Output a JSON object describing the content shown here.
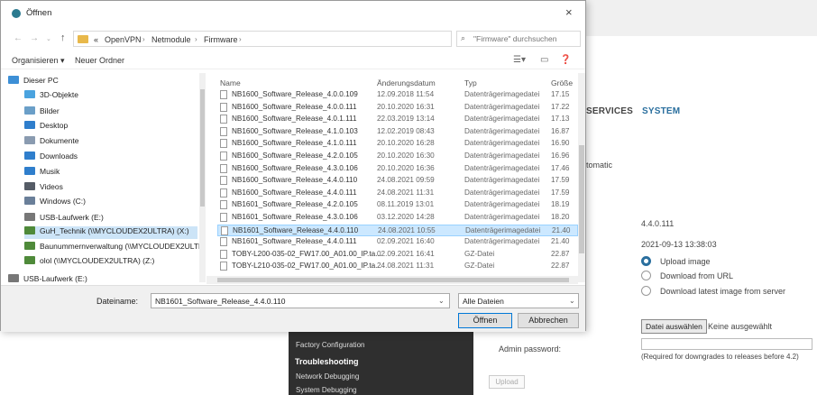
{
  "dialog": {
    "title": "Öffnen",
    "close": "×",
    "breadcrumb": [
      "«",
      "OpenVPN",
      "Netmodule",
      "Firmware"
    ],
    "search_placeholder": "\"Firmware\" durchsuchen",
    "toolbar": {
      "organize": "Organisieren ▾",
      "new_folder": "Neuer Ordner"
    },
    "nav_items": [
      {
        "label": "Dieser PC",
        "icon": "monitor-icon",
        "color": "#3d8fd6"
      },
      {
        "label": "3D-Objekte",
        "icon": "cube-icon",
        "color": "#4aa3df"
      },
      {
        "label": "Bilder",
        "icon": "pictures-icon",
        "color": "#6b9fc8"
      },
      {
        "label": "Desktop",
        "icon": "desktop-icon",
        "color": "#2f7ecc"
      },
      {
        "label": "Dokumente",
        "icon": "document-icon",
        "color": "#8a9bb0"
      },
      {
        "label": "Downloads",
        "icon": "download-icon",
        "color": "#2f7ecc"
      },
      {
        "label": "Musik",
        "icon": "music-icon",
        "color": "#2f7ecc"
      },
      {
        "label": "Videos",
        "icon": "video-icon",
        "color": "#555c66"
      },
      {
        "label": "Windows (C:)",
        "icon": "drive-icon",
        "color": "#6a7f99"
      },
      {
        "label": "USB-Laufwerk (E:)",
        "icon": "usb-drive-icon",
        "color": "#777"
      },
      {
        "label": "GuH_Technik (\\\\MYCLOUDEX2ULTRA) (X:)",
        "icon": "network-drive-icon",
        "color": "#4f8a3a",
        "selected": true
      },
      {
        "label": "Baunummernverwaltung (\\\\MYCLOUDEX2ULTR",
        "icon": "network-drive-icon",
        "color": "#4f8a3a"
      },
      {
        "label": "olol (\\\\MYCLOUDEX2ULTRA) (Z:)",
        "icon": "network-drive-icon",
        "color": "#4f8a3a"
      },
      {
        "label": "USB-Laufwerk (E:)",
        "icon": "usb-drive-icon",
        "color": "#777"
      }
    ],
    "columns": {
      "name": "Name",
      "date": "Änderungsdatum",
      "type": "Typ",
      "size": "Größe"
    },
    "files": [
      {
        "name": "NB1600_Software_Release_4.0.0.109",
        "date": "12.09.2018 11:54",
        "type": "Datenträgerimagedatei",
        "size": "17.15"
      },
      {
        "name": "NB1600_Software_Release_4.0.0.111",
        "date": "20.10.2020 16:31",
        "type": "Datenträgerimagedatei",
        "size": "17.22"
      },
      {
        "name": "NB1600_Software_Release_4.0.1.111",
        "date": "22.03.2019 13:14",
        "type": "Datenträgerimagedatei",
        "size": "17.13"
      },
      {
        "name": "NB1600_Software_Release_4.1.0.103",
        "date": "12.02.2019 08:43",
        "type": "Datenträgerimagedatei",
        "size": "16.87"
      },
      {
        "name": "NB1600_Software_Release_4.1.0.111",
        "date": "20.10.2020 16:28",
        "type": "Datenträgerimagedatei",
        "size": "16.90"
      },
      {
        "name": "NB1600_Software_Release_4.2.0.105",
        "date": "20.10.2020 16:30",
        "type": "Datenträgerimagedatei",
        "size": "16.96"
      },
      {
        "name": "NB1600_Software_Release_4.3.0.106",
        "date": "20.10.2020 16:36",
        "type": "Datenträgerimagedatei",
        "size": "17.46"
      },
      {
        "name": "NB1600_Software_Release_4.4.0.110",
        "date": "24.08.2021 09:59",
        "type": "Datenträgerimagedatei",
        "size": "17.59"
      },
      {
        "name": "NB1600_Software_Release_4.4.0.111",
        "date": "24.08.2021 11:31",
        "type": "Datenträgerimagedatei",
        "size": "17.59"
      },
      {
        "name": "NB1601_Software_Release_4.2.0.105",
        "date": "08.11.2019 13:01",
        "type": "Datenträgerimagedatei",
        "size": "18.19"
      },
      {
        "name": "NB1601_Software_Release_4.3.0.106",
        "date": "03.12.2020 14:28",
        "type": "Datenträgerimagedatei",
        "size": "18.20"
      },
      {
        "name": "NB1601_Software_Release_4.4.0.110",
        "date": "24.08.2021 10:55",
        "type": "Datenträgerimagedatei",
        "size": "21.40",
        "selected": true
      },
      {
        "name": "NB1601_Software_Release_4.4.0.111",
        "date": "02.09.2021 16:40",
        "type": "Datenträgerimagedatei",
        "size": "21.40"
      },
      {
        "name": "TOBY-L200-035-02_FW17.00_A01.00_IP.ta...",
        "date": "02.09.2021 16:41",
        "type": "GZ-Datei",
        "size": "22.87"
      },
      {
        "name": "TOBY-L210-035-02_FW17.00_A01.00_IP.ta...",
        "date": "24.08.2021 11:31",
        "type": "GZ-Datei",
        "size": "22.87"
      }
    ],
    "filename_label": "Dateiname:",
    "filename_value": "NB1601_Software_Release_4.4.0.110",
    "filter_value": "Alle Dateien",
    "open_button": "Öffnen",
    "cancel_button": "Abbrechen"
  },
  "background": {
    "nav_services": "SERVICES",
    "nav_system": "SYSTEM",
    "automatic_text": "tomatic",
    "version": "4.4.0.111",
    "datetime": "2021-09-13 13:38:03",
    "upload_options": [
      "Upload image",
      "Download from URL",
      "Download latest image from server"
    ],
    "choose_file": "Datei auswählen",
    "no_file": "Keine ausgewählt",
    "admin_password_label": "Admin password:",
    "downgrade_note": "(Required for downgrades to releases before 4.2)",
    "upload_button": "Upload",
    "sidebar": {
      "factory_configuration": "Factory Configuration",
      "troubleshooting": "Troubleshooting",
      "network_debugging": "Network Debugging",
      "system_debugging": "System Debugging"
    }
  }
}
